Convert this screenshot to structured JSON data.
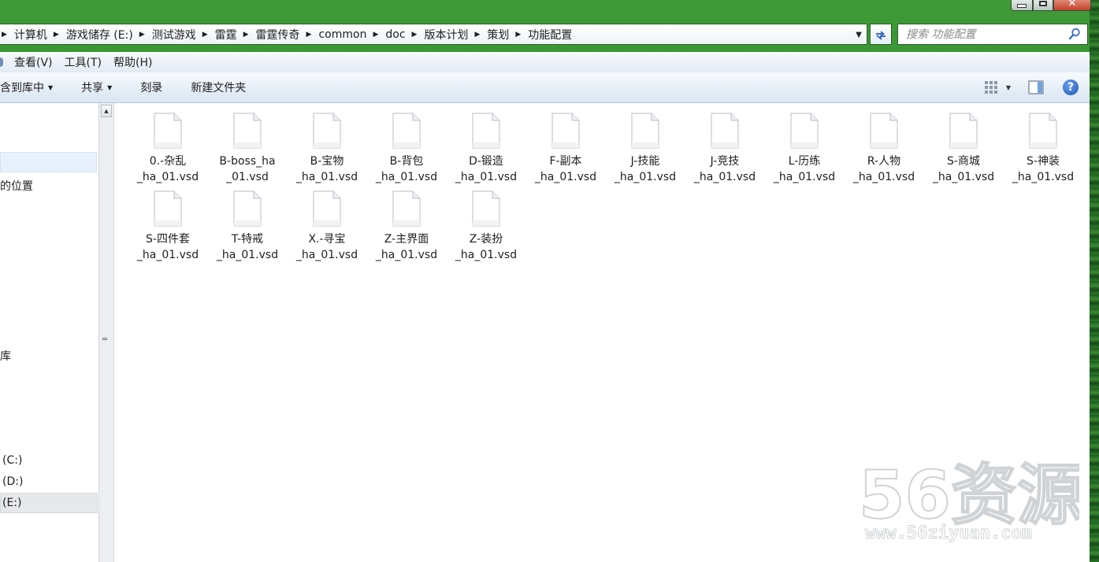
{
  "window": {
    "close_glyph": "✕"
  },
  "address": {
    "breadcrumbs": [
      "计算机",
      "游戏储存 (E:)",
      "测试游戏",
      "雷霆",
      "雷霆传奇",
      "common",
      "doc",
      "版本计划",
      "策划",
      "功能配置"
    ]
  },
  "search": {
    "placeholder": "搜索 功能配置"
  },
  "menubar": {
    "items": [
      "查看(V)",
      "工具(T)",
      "帮助(H)"
    ]
  },
  "toolbar": {
    "include_in_library": "含到库中",
    "share": "共享",
    "burn": "刻录",
    "new_folder": "新建文件夹",
    "help_glyph": "?"
  },
  "navpane": {
    "recent_places": "的位置",
    "libraries": "库",
    "drives": [
      {
        "label": "(C:)"
      },
      {
        "label": "(D:)"
      },
      {
        "label": "(E:)",
        "selected": true
      }
    ]
  },
  "files": [
    {
      "line1": "0.-杂乱",
      "line2": "_ha_01.vsd"
    },
    {
      "line1": "B-boss_ha",
      "line2": "_01.vsd"
    },
    {
      "line1": "B-宝物",
      "line2": "_ha_01.vsd"
    },
    {
      "line1": "B-背包",
      "line2": "_ha_01.vsd"
    },
    {
      "line1": "D-锻造",
      "line2": "_ha_01.vsd"
    },
    {
      "line1": "F-副本",
      "line2": "_ha_01.vsd"
    },
    {
      "line1": "J-技能",
      "line2": "_ha_01.vsd"
    },
    {
      "line1": "J-竞技",
      "line2": "_ha_01.vsd"
    },
    {
      "line1": "L-历练",
      "line2": "_ha_01.vsd"
    },
    {
      "line1": "R-人物",
      "line2": "_ha_01.vsd"
    },
    {
      "line1": "S-商城",
      "line2": "_ha_01.vsd"
    },
    {
      "line1": "S-神装",
      "line2": "_ha_01.vsd"
    },
    {
      "line1": "S-四件套",
      "line2": "_ha_01.vsd"
    },
    {
      "line1": "T-特戒",
      "line2": "_ha_01.vsd"
    },
    {
      "line1": "X.-寻宝",
      "line2": "_ha_01.vsd"
    },
    {
      "line1": "Z-主界面",
      "line2": "_ha_01.vsd"
    },
    {
      "line1": "Z-装扮",
      "line2": "_ha_01.vsd"
    }
  ],
  "watermark": {
    "brand": "56资源",
    "url": "www.56ziyuan.com"
  },
  "colors": {
    "frame_green": "#2b8e2b",
    "selection_blue": "#e8f1fb",
    "help_blue": "#1f55b5"
  }
}
